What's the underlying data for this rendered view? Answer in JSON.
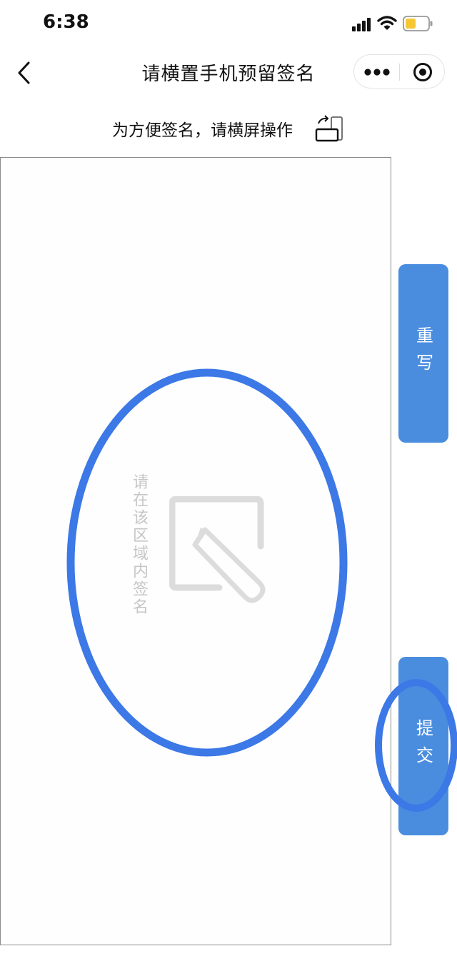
{
  "status_bar": {
    "time": "6:38"
  },
  "nav": {
    "title": "请横置手机预留签名"
  },
  "hint": {
    "text": "为方便签名，请横屏操作"
  },
  "signature_area": {
    "placeholder": "请在该区域内签名"
  },
  "buttons": {
    "rewrite": "重写",
    "submit": "提交"
  },
  "colors": {
    "accent": "#4a8ddf",
    "annotation": "#3c78e6"
  },
  "icons": {
    "back": "back-chevron-icon",
    "more": "more-dots-icon",
    "close": "close-target-icon",
    "rotate": "rotate-phone-icon",
    "pen": "pen-square-icon"
  }
}
